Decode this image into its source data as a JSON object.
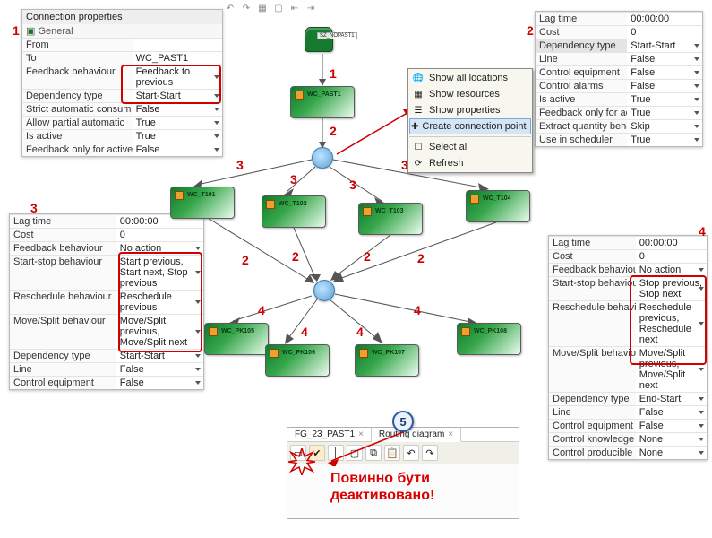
{
  "colors": {
    "accent_red": "#d00000",
    "node_green": "#167a2f"
  },
  "top_toolbar_icons": [
    "undo",
    "redo",
    "sep",
    "grid",
    "snap",
    "align-l",
    "align-r",
    "align-t",
    "align-b"
  ],
  "panel1": {
    "title": "Connection properties",
    "section": "General",
    "rows": [
      {
        "k": "From",
        "v": ""
      },
      {
        "k": "To",
        "v": "WC_PAST1"
      },
      {
        "k": "Feedback behaviour",
        "v": "Feedback to previous",
        "dd": true,
        "hl": true
      },
      {
        "k": "Dependency type",
        "v": "Start-Start",
        "dd": true,
        "hl": true
      },
      {
        "k": "Strict automatic consum",
        "v": "False",
        "dd": true
      },
      {
        "k": "Allow partial automatic",
        "v": "True",
        "dd": true
      },
      {
        "k": "Is active",
        "v": "True",
        "dd": true
      },
      {
        "k": "Feedback only for active",
        "v": "False",
        "dd": true
      }
    ]
  },
  "panel2": {
    "rows": [
      {
        "k": "Lag time",
        "v": "00:00:00"
      },
      {
        "k": "Cost",
        "v": "0"
      },
      {
        "k": "Dependency type",
        "v": "Start-Start",
        "dd": true,
        "shade": true
      },
      {
        "k": "Line",
        "v": "False",
        "dd": true
      },
      {
        "k": "Control equipment",
        "v": "False",
        "dd": true
      },
      {
        "k": "Control alarms",
        "v": "False",
        "dd": true
      },
      {
        "k": "Is active",
        "v": "True",
        "dd": true
      },
      {
        "k": "Feedback only for active",
        "v": "True",
        "dd": true
      },
      {
        "k": "Extract quantity behaviour",
        "v": "Skip",
        "dd": true
      },
      {
        "k": "Use in scheduler",
        "v": "True",
        "dd": true
      }
    ]
  },
  "panel3": {
    "rows": [
      {
        "k": "Lag time",
        "v": "00:00:00"
      },
      {
        "k": "Cost",
        "v": "0"
      },
      {
        "k": "Feedback behaviour",
        "v": "No action",
        "dd": true
      },
      {
        "k": "Start-stop behaviour",
        "v": "Start previous, Start next, Stop previous",
        "dd": true,
        "hl": true
      },
      {
        "k": "Reschedule behaviour",
        "v": "Reschedule previous",
        "dd": true,
        "hl": true
      },
      {
        "k": "Move/Split behaviour",
        "v": "Move/Split previous, Move/Split next",
        "dd": true,
        "hl": true
      },
      {
        "k": "Dependency type",
        "v": "Start-Start",
        "dd": true
      },
      {
        "k": "Line",
        "v": "False",
        "dd": true
      },
      {
        "k": "Control equipment",
        "v": "False",
        "dd": true
      }
    ]
  },
  "panel4": {
    "rows": [
      {
        "k": "Lag time",
        "v": "00:00:00"
      },
      {
        "k": "Cost",
        "v": "0"
      },
      {
        "k": "Feedback behaviour",
        "v": "No action",
        "dd": true
      },
      {
        "k": "Start-stop behaviour",
        "v": "Stop previous, Stop next",
        "dd": true,
        "hl": true
      },
      {
        "k": "Reschedule behaviour",
        "v": "Reschedule previous, Reschedule next",
        "dd": true,
        "hl": true
      },
      {
        "k": "Move/Split behaviour",
        "v": "Move/Split previous, Move/Split next",
        "dd": true,
        "hl": true
      },
      {
        "k": "Dependency type",
        "v": "End-Start",
        "dd": true,
        "hl": true
      },
      {
        "k": "Line",
        "v": "False",
        "dd": true
      },
      {
        "k": "Control equipment",
        "v": "False",
        "dd": true
      },
      {
        "k": "Control knowledge",
        "v": "None",
        "dd": true
      },
      {
        "k": "Control producible units",
        "v": "None",
        "dd": true
      }
    ]
  },
  "ctxmenu": {
    "items": [
      {
        "icon": "globe-icon",
        "label": "Show all locations"
      },
      {
        "icon": "cubes-icon",
        "label": "Show resources"
      },
      {
        "icon": "props-icon",
        "label": "Show properties"
      },
      {
        "icon": "connect-icon",
        "label": "Create connection point",
        "selected": true
      },
      {
        "sep": true
      },
      {
        "icon": "select-icon",
        "label": "Select all"
      },
      {
        "icon": "refresh-icon",
        "label": "Refresh"
      }
    ]
  },
  "nodes": {
    "db": {
      "label": "SZ_NOPAST1"
    },
    "past1": {
      "label": "WC_PAST1"
    },
    "t101": {
      "label": "WC_T101"
    },
    "t102": {
      "label": "WC_T102"
    },
    "t103": {
      "label": "WC_T103"
    },
    "t104": {
      "label": "WC_T104"
    },
    "pk105": {
      "label": "WC_PK105"
    },
    "pk106": {
      "label": "WC_PK106"
    },
    "pk107": {
      "label": "WC_PK107"
    },
    "pk108": {
      "label": "WC_PK108"
    }
  },
  "edge_labels": {
    "e1": "1",
    "e2a": "2",
    "e3a": "3",
    "e3b": "3",
    "e3c": "3",
    "e3d": "3",
    "e2b": "2",
    "e2c": "2",
    "e2d": "2",
    "e2e": "2",
    "e4a": "4",
    "e4b": "4",
    "e4c": "4",
    "e4d": "4"
  },
  "callouts": {
    "c1": "1",
    "c2": "2",
    "c3": "3",
    "c4": "4"
  },
  "detail5": {
    "tabs": [
      {
        "label": "FG_23_PAST1",
        "close": true
      },
      {
        "label": "Routing diagram",
        "close": true,
        "active": true
      }
    ],
    "step": "5",
    "warning": "Повинно бути деактивовано!",
    "toolbar_icons": [
      "box",
      "check",
      "line",
      "sep",
      "rect",
      "copy",
      "paste",
      "sep",
      "undo",
      "redo"
    ]
  }
}
